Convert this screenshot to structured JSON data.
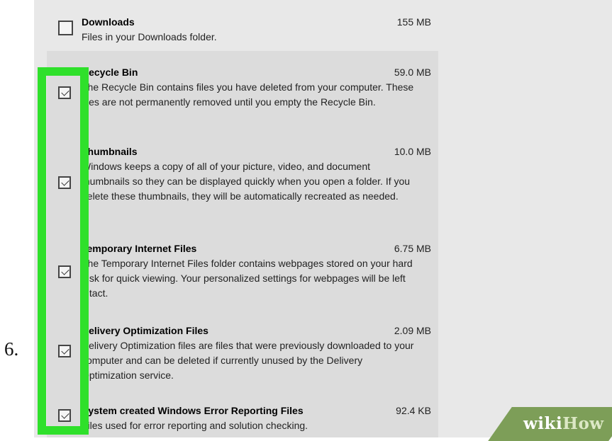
{
  "step_number": "6.",
  "items": [
    {
      "title": "Downloads",
      "size": "155 MB",
      "desc": "Files in your Downloads folder.",
      "checked": false
    },
    {
      "title": "Recycle Bin",
      "size": "59.0 MB",
      "desc": "The Recycle Bin contains files you have deleted from your computer. These files are not permanently removed until you empty the Recycle Bin.",
      "checked": true
    },
    {
      "title": "Thumbnails",
      "size": "10.0 MB",
      "desc": "Windows keeps a copy of all of your picture, video, and document thumbnails so they can be displayed quickly when you open a folder. If you delete these thumbnails, they will be automatically recreated as needed.",
      "checked": true
    },
    {
      "title": "Temporary Internet Files",
      "size": "6.75 MB",
      "desc": "The Temporary Internet Files folder contains webpages stored on your hard disk for quick viewing. Your personalized settings for webpages will be left intact.",
      "checked": true
    },
    {
      "title": "Delivery Optimization Files",
      "size": "2.09 MB",
      "desc": "Delivery Optimization files are files that were previously downloaded to your computer and can be deleted if currently unused by the Delivery Optimization service.",
      "checked": true
    },
    {
      "title": "System created Windows Error Reporting Files",
      "size": "92.4 KB",
      "desc": "Files used for error reporting and solution checking.",
      "checked": true
    }
  ],
  "watermark": {
    "part1": "wiki",
    "part2": "How"
  },
  "colors": {
    "highlight": "#2fe02b",
    "panel": "#e8e8e8",
    "list_selected": "#dcdcdc",
    "watermark": "#7d9e58"
  }
}
